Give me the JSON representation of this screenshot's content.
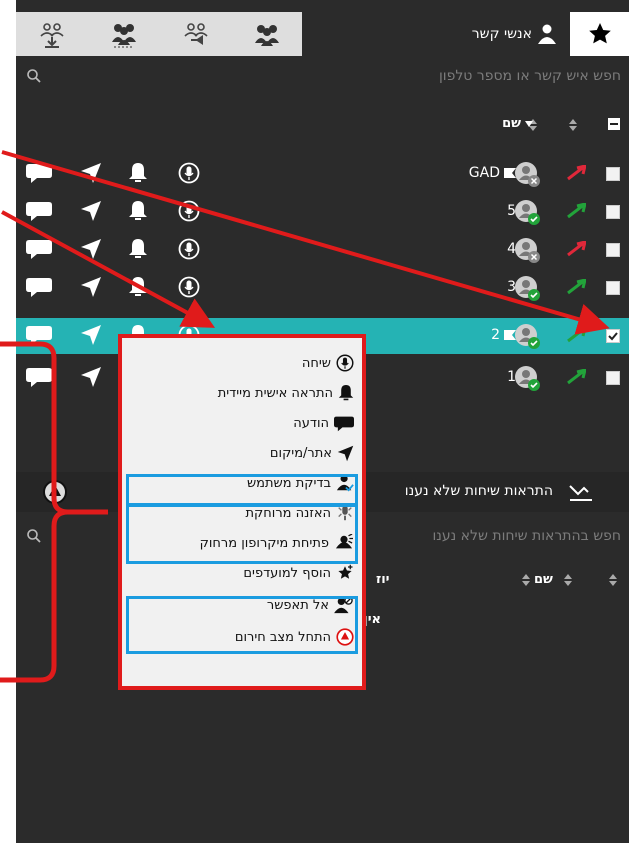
{
  "tabs": {
    "contacts_label": "אנשי קשר"
  },
  "contacts_search": {
    "placeholder": "חפש איש קשר או מספר טלפון"
  },
  "table_header": {
    "name": "שם"
  },
  "contacts": [
    {
      "name": "GAD",
      "flag": true,
      "status": "offline",
      "selected": false,
      "arrow": "red"
    },
    {
      "name": "5",
      "flag": false,
      "status": "online",
      "selected": false,
      "arrow": "green"
    },
    {
      "name": "4",
      "flag": false,
      "status": "offline",
      "selected": false,
      "arrow": "red"
    },
    {
      "name": "3",
      "flag": false,
      "status": "online",
      "selected": false,
      "arrow": "green"
    },
    {
      "name": "2",
      "flag": true,
      "status": "online",
      "selected": true,
      "arrow": "green"
    },
    {
      "name": "1",
      "flag": false,
      "status": "online",
      "selected": false,
      "arrow": "green"
    }
  ],
  "alerts_section": {
    "title": "התראות שיחות שלא נענו",
    "search_placeholder": "חפש בהתראות שיחות שלא נענו",
    "col_name": "שם",
    "col_from": "יוז",
    "empty_text": "אין התרא"
  },
  "context_menu": {
    "items": [
      {
        "label": "שיחה",
        "icon": "microphone-icon",
        "highlighted": false
      },
      {
        "label": "התראה אישית מיידית",
        "icon": "bell-icon",
        "highlighted": false
      },
      {
        "label": "הודעה",
        "icon": "chat-bubble-icon",
        "highlighted": false
      },
      {
        "label": "אתר/מיקום",
        "icon": "location-arrow-icon",
        "highlighted": false
      },
      {
        "label": "בדיקת משתמש",
        "icon": "user-check-icon",
        "highlighted": true
      },
      {
        "label": "האזנה מרוחקת",
        "icon": "remote-listen-icon",
        "highlighted": true
      },
      {
        "label": "פתיחת מיקרופון מרחוק",
        "icon": "remote-mic-icon",
        "highlighted": true
      },
      {
        "label": "הוסף למועדפים",
        "icon": "star-add-icon",
        "highlighted": false
      },
      {
        "label": "אל תאפשר",
        "icon": "user-block-icon",
        "highlighted": true
      },
      {
        "label": "התחל מצב חירום",
        "icon": "emergency-icon",
        "highlighted": true
      }
    ]
  },
  "colors": {
    "panel_bg": "#2b2b2b",
    "selected_row": "#25b3b4",
    "annotation_red": "#e01b1b",
    "annotation_blue": "#1b9ce0",
    "status_green": "#22a33a"
  }
}
